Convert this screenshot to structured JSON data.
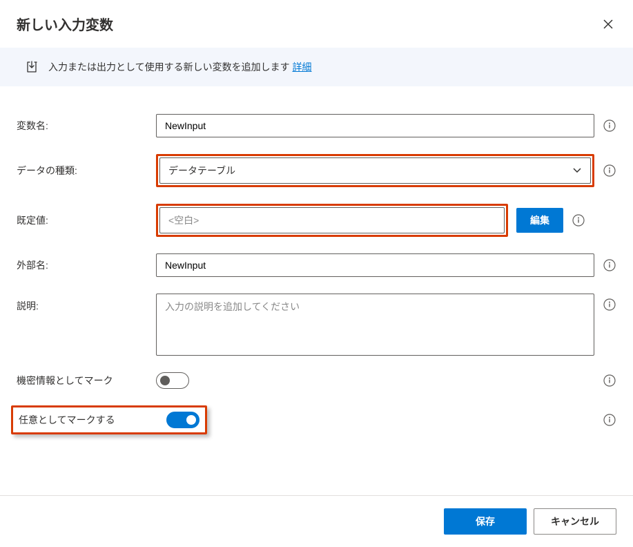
{
  "dialog": {
    "title": "新しい入力変数"
  },
  "banner": {
    "text": "入力または出力として使用する新しい変数を追加します",
    "details_link": "詳細"
  },
  "fields": {
    "var_name": {
      "label": "変数名:",
      "value": "NewInput"
    },
    "data_type": {
      "label": "データの種類:",
      "value": "データテーブル"
    },
    "default_value": {
      "label": "既定値:",
      "value": "<空白>",
      "edit_label": "編集"
    },
    "external_name": {
      "label": "外部名:",
      "value": "NewInput"
    },
    "description": {
      "label": "説明:",
      "placeholder": "入力の説明を追加してください"
    },
    "sensitive": {
      "label": "機密情報としてマーク"
    },
    "optional": {
      "label": "任意としてマークする"
    }
  },
  "footer": {
    "save": "保存",
    "cancel": "キャンセル"
  }
}
